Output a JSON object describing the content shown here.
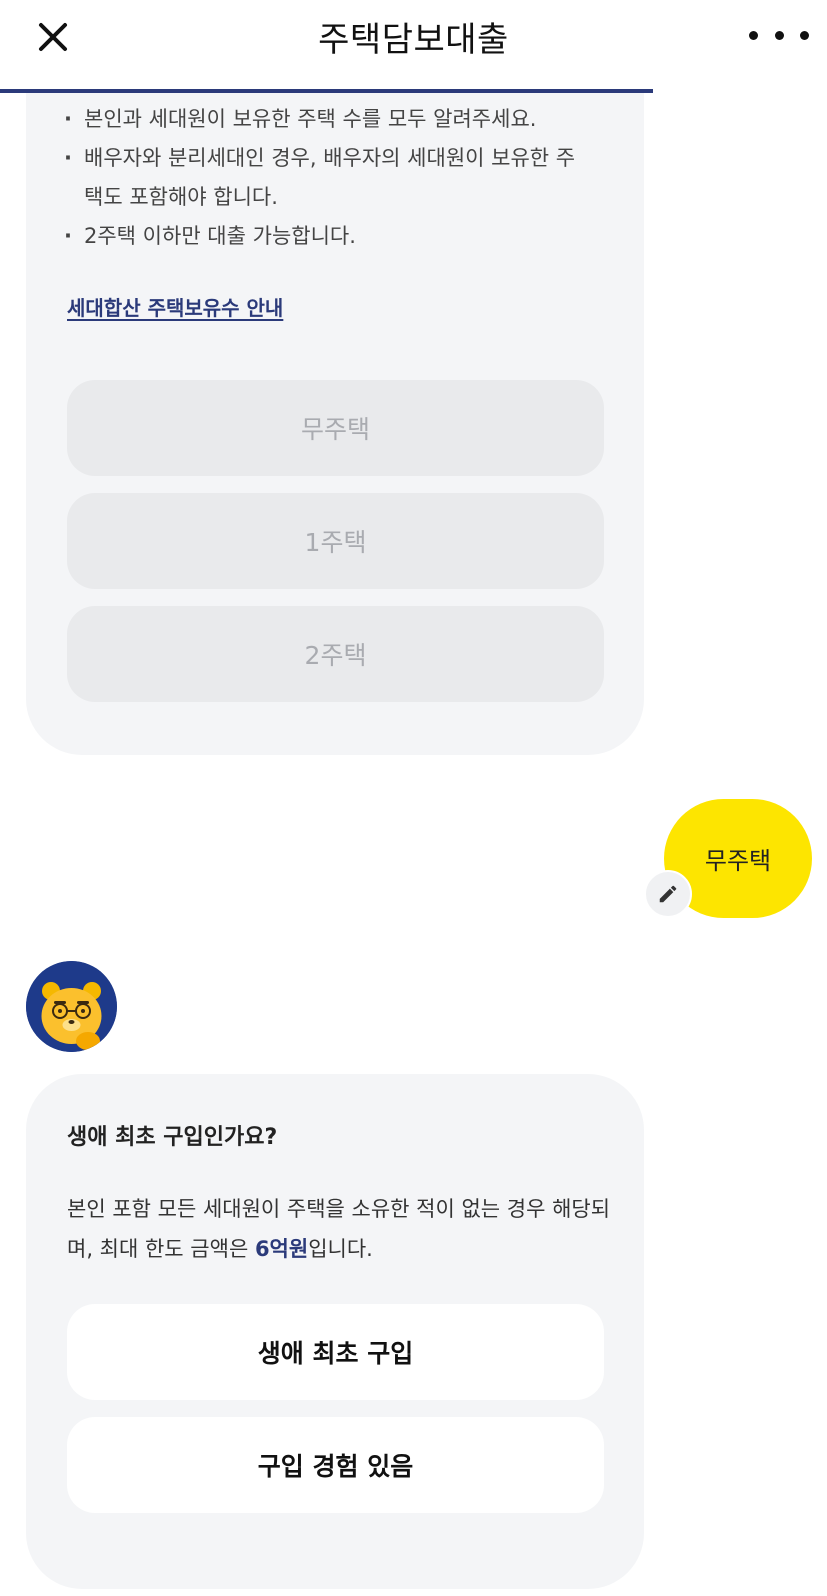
{
  "header": {
    "title": "주택담보대출",
    "progress_percent": 79
  },
  "card1": {
    "bullets": [
      "본인과 세대원이 보유한 주택 수를 모두 알려주세요.",
      "배우자와 분리세대인 경우, 배우자의 세대원이 보유한 주택도 포함해야 합니다.",
      "2주택 이하만 대출 가능합니다."
    ],
    "link": "세대합산 주택보유수 안내",
    "options": [
      "무주택",
      "1주택",
      "2주택"
    ]
  },
  "user_reply": {
    "text": "무주택"
  },
  "card2": {
    "question": "생애 최초 구입인가요?",
    "desc_before": "본인 포함 모든 세대원이 주택을 소유한 적이 없는 경우 해당되며, 최대 한도 금액은 ",
    "desc_highlight": "6억원",
    "desc_after": "입니다.",
    "options": [
      "생애 최초 구입",
      "구입 경험 있음"
    ]
  },
  "colors": {
    "accent": "#2b3a7a",
    "bubble": "#fde500",
    "card_bg": "#f4f5f7"
  },
  "icons": {
    "close": "close-icon",
    "more": "more-icon",
    "edit": "pencil-icon",
    "avatar": "bear-character-avatar"
  }
}
